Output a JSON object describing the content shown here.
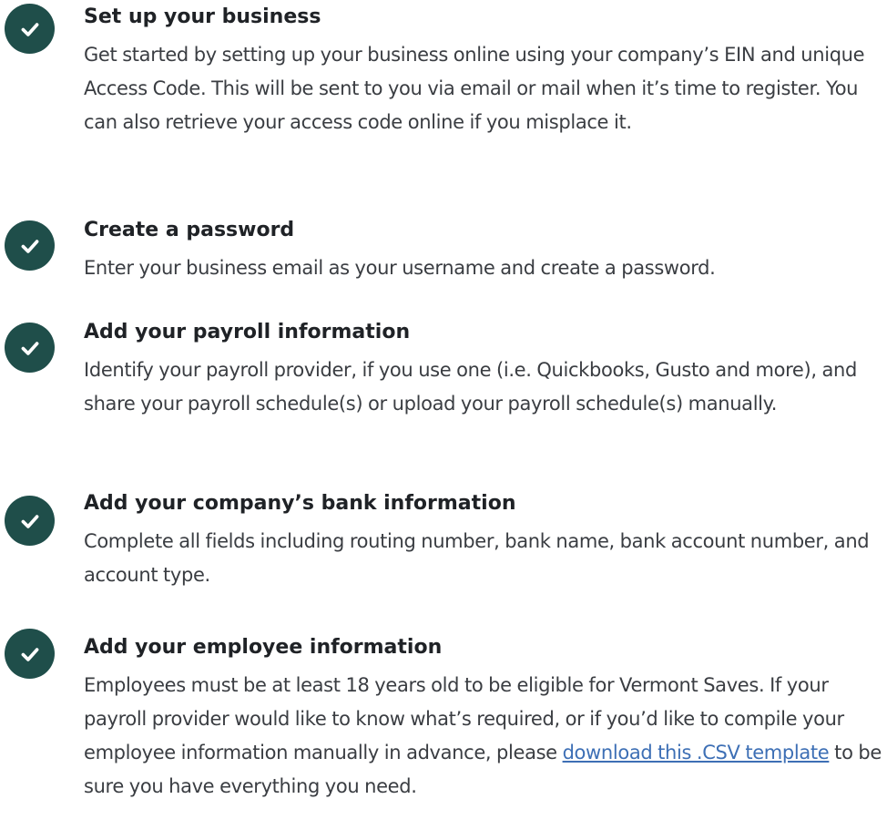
{
  "steps": [
    {
      "title": "Set up your business",
      "description": "Get started by setting up your business online using your company’s EIN and unique Access Code. This will be sent to you via email or mail when it’s time to register. You can also retrieve your access code online if you misplace it."
    },
    {
      "title": "Create a password",
      "description": "Enter your business email as your username and create a password."
    },
    {
      "title": "Add your payroll information",
      "description": "Identify your payroll provider, if you use one (i.e. Quickbooks, Gusto and more), and share your payroll schedule(s) or upload your payroll schedule(s) manually."
    },
    {
      "title": "Add your company’s bank information",
      "description": "Complete all fields including routing number, bank name, bank account number, and account type."
    },
    {
      "title": "Add your employee information",
      "description_before": "Employees must be at least 18 years old to be eligible for Vermont Saves. If your payroll provider would like to know what’s required, or if you’d like to compile your employee information manually in advance, please ",
      "link_text": "download this .CSV template",
      "description_after": " to be sure you have everything you need."
    }
  ],
  "colors": {
    "check_background": "#1f4e4a",
    "check_mark": "#ffffff",
    "link": "#3d6fb5"
  },
  "icons": {
    "step_status": "check-circle-icon"
  }
}
